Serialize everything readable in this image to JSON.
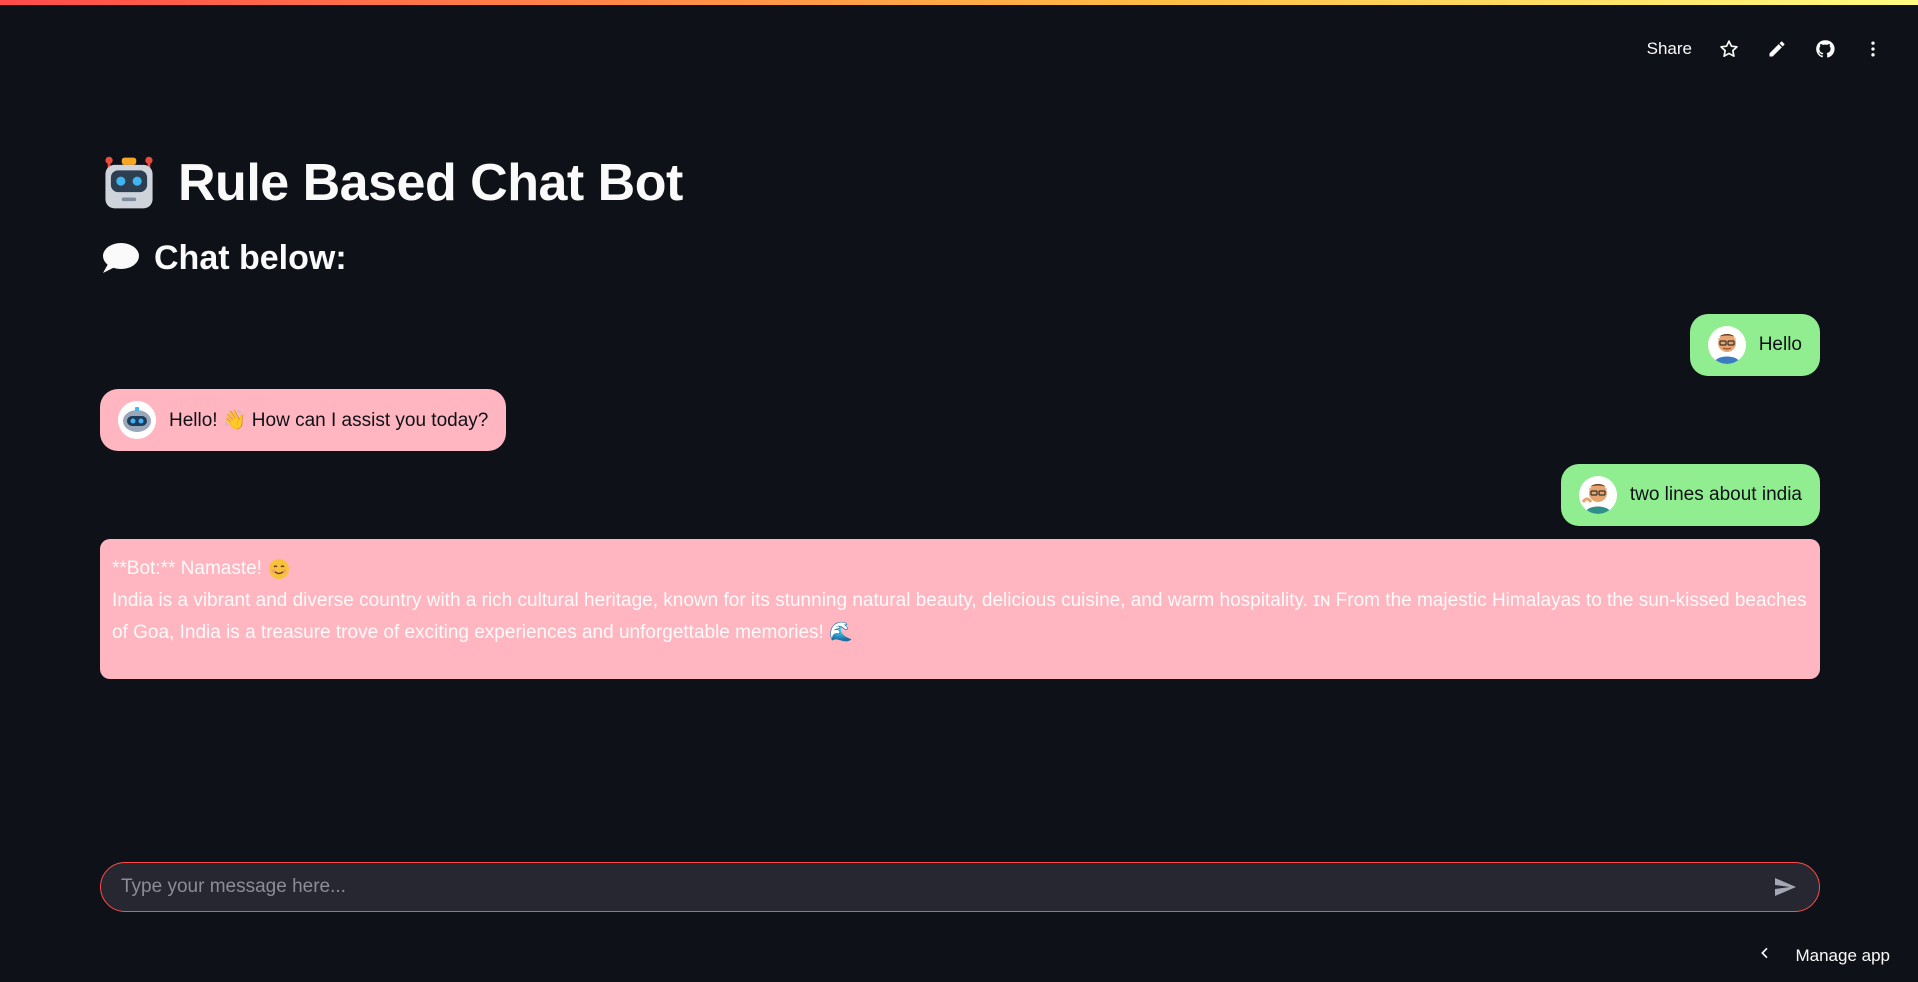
{
  "toolbar": {
    "share_label": "Share",
    "icons": [
      "star-icon",
      "edit-icon",
      "github-icon",
      "more-vertical-icon"
    ]
  },
  "header": {
    "title": "Rule Based Chat Bot",
    "title_icon": "robot-emoji",
    "subtitle": "Chat below:",
    "subtitle_icon": "speech-balloon-emoji"
  },
  "messages": [
    {
      "role": "user",
      "text": "Hello"
    },
    {
      "role": "bot",
      "text": "Hello! 👋 How can I assist you today?"
    },
    {
      "role": "user",
      "text": "two lines about india"
    },
    {
      "role": "bot",
      "prefix": "**Bot:** Namaste!",
      "body": "India is a vibrant and diverse country with a rich cultural heritage, known for its stunning natural beauty, delicious cuisine, and warm hospitality. ɪɴ From the majestic Himalayas to the sun-kissed beaches of Goa, India is a treasure trove of exciting experiences and unforgettable memories! 🌊"
    }
  ],
  "chat_input": {
    "placeholder": "Type your message here...",
    "value": ""
  },
  "footer": {
    "manage_app_label": "Manage app"
  },
  "colors": {
    "background": "#0e1117",
    "user_bubble": "#90ee90",
    "bot_bubble": "#ffb6c1",
    "accent": "#ff4b4b"
  }
}
